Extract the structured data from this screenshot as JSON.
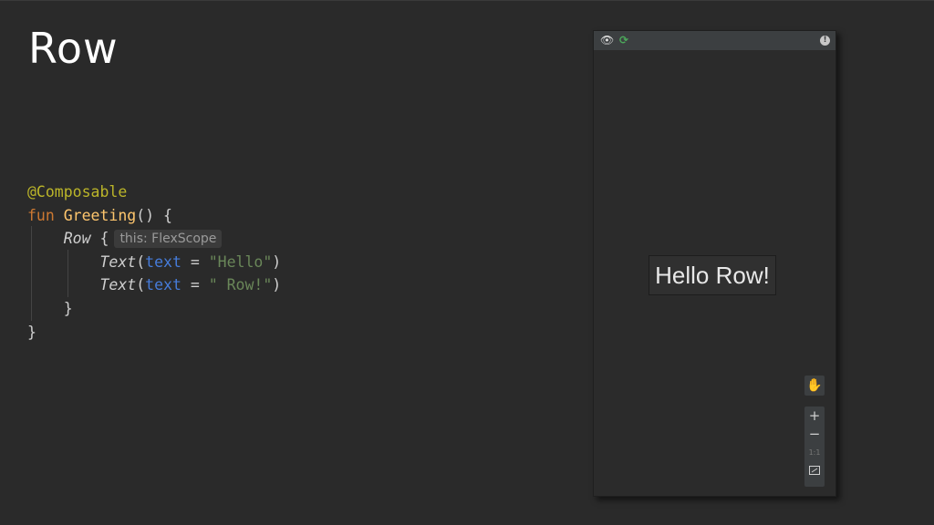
{
  "slide": {
    "title": "Row"
  },
  "code": {
    "annotation": "@Composable",
    "fun_kw": "fun",
    "fn_name": "Greeting",
    "fn_rest": "() {",
    "row_call": "Row",
    "row_brace": " {",
    "hint": "this: FlexScope",
    "text_call": "Text",
    "open_paren": "(",
    "param": "text",
    "eq": " = ",
    "str1": "\"Hello\"",
    "str2": "\" Row!\"",
    "close_paren": ")",
    "close_inner": "}",
    "close_outer": "}"
  },
  "preview": {
    "toolbar": {
      "eye_icon": "eye-icon",
      "refresh_icon": "refresh-icon",
      "warning_icon": "warning-icon"
    },
    "rendered_text": "Hello Row!",
    "zoom": {
      "in": "+",
      "out": "−",
      "one_to_one": "1:1",
      "fit_icon": "fit-screen-icon",
      "pan_icon": "hand-icon"
    }
  }
}
